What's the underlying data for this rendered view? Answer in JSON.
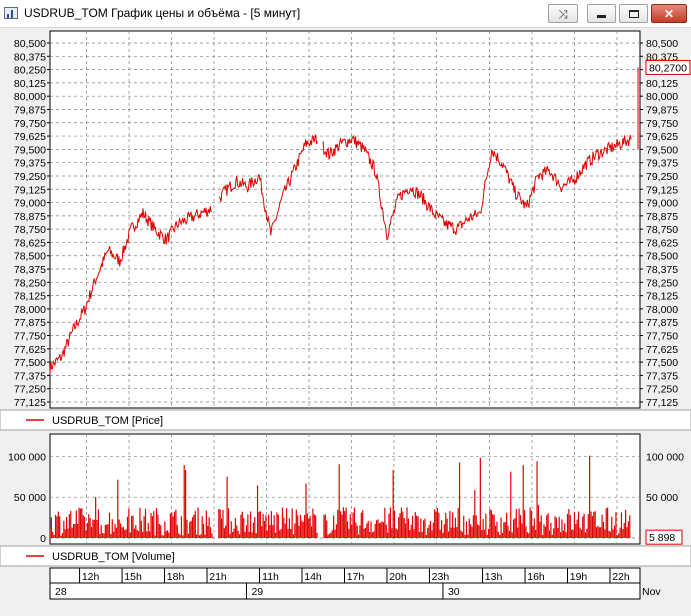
{
  "window": {
    "title": "USDRUB_TOM График цены и объёма - [5 минут]",
    "icons": {
      "pin": "pin-icon",
      "minimize": "minimize-icon",
      "maximize": "maximize-icon",
      "close": "close-icon"
    }
  },
  "colors": {
    "series": "#e00000",
    "grid": "#808080",
    "panel": "#ffffff",
    "frame": "#f0f0f0"
  },
  "chart_data": [
    {
      "type": "line",
      "name": "price",
      "legend": "USDRUB_TOM [Price]",
      "ylim": [
        77.125,
        80.5
      ],
      "yticks": [
        "80,500",
        "80,375",
        "80,250",
        "80,125",
        "80,000",
        "79,875",
        "79,750",
        "79,625",
        "79,500",
        "79,375",
        "79,250",
        "79,125",
        "79,000",
        "78,875",
        "78,750",
        "78,625",
        "78,500",
        "78,375",
        "78,250",
        "78,125",
        "78,000",
        "77,875",
        "77,750",
        "77,625",
        "77,500",
        "77,375",
        "77,250",
        "77,125"
      ],
      "last_value": "80,2700",
      "series": [
        {
          "name": "USDRUB_TOM",
          "x": [
            0,
            2,
            4,
            6,
            8,
            10,
            12,
            14,
            16,
            18,
            20,
            22,
            24,
            26,
            28,
            30,
            32,
            34,
            36,
            38,
            40,
            42,
            44,
            46,
            48,
            50,
            52,
            54,
            56,
            58,
            60,
            62,
            64,
            66,
            68,
            70,
            72,
            74,
            76,
            78,
            80,
            82,
            84,
            86,
            88,
            90,
            92,
            94,
            96,
            98,
            100
          ],
          "values": [
            77.45,
            77.55,
            77.8,
            78.0,
            78.3,
            78.55,
            78.45,
            78.75,
            78.9,
            78.75,
            78.65,
            78.8,
            78.85,
            78.9,
            78.95,
            79.1,
            79.2,
            79.15,
            79.25,
            78.7,
            79.05,
            79.3,
            79.55,
            79.6,
            79.45,
            79.55,
            79.6,
            79.5,
            79.3,
            78.7,
            79.05,
            79.15,
            79.05,
            78.9,
            78.8,
            78.75,
            78.85,
            78.9,
            79.5,
            79.35,
            79.1,
            78.95,
            79.25,
            79.3,
            79.15,
            79.2,
            79.35,
            79.45,
            79.5,
            79.55,
            79.6
          ]
        }
      ],
      "gaps": [
        [
          28,
          29
        ],
        [
          46,
          47
        ]
      ]
    },
    {
      "type": "bar",
      "name": "volume",
      "legend": "USDRUB_TOM [Volume]",
      "ylim": [
        0,
        120000
      ],
      "yticks": [
        "100 000",
        "50 000",
        "0"
      ],
      "ytick_values": [
        100000,
        50000,
        0
      ],
      "last_value": "5 898"
    }
  ],
  "time_axis": {
    "hour_labels": [
      "12h",
      "15h",
      "18h",
      "21h",
      "11h",
      "14h",
      "17h",
      "20h",
      "23h",
      "13h",
      "16h",
      "19h",
      "22h"
    ],
    "hour_positions": [
      0.062,
      0.134,
      0.206,
      0.278,
      0.367,
      0.439,
      0.511,
      0.583,
      0.655,
      0.745,
      0.817,
      0.889,
      0.961
    ],
    "day_labels": [
      "28",
      "29",
      "30"
    ],
    "day_positions": [
      0.0,
      0.333,
      0.666
    ],
    "month_label": "Nov"
  }
}
